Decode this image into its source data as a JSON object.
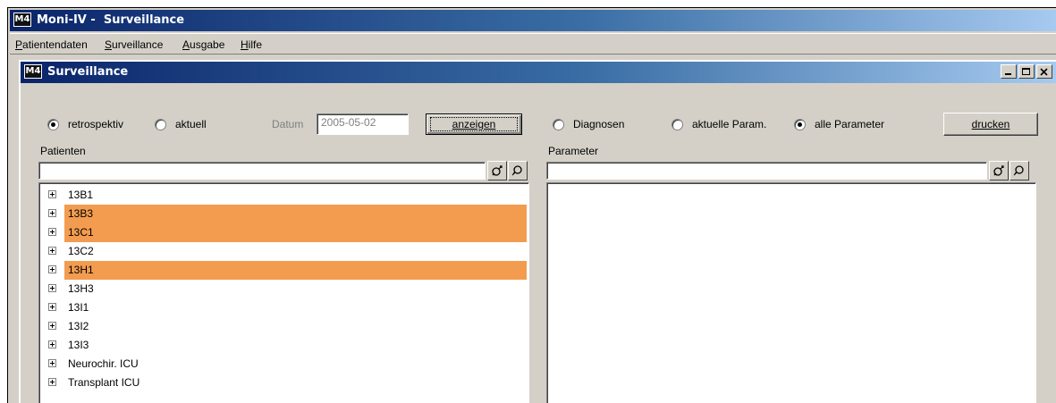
{
  "app": {
    "icon_text": "M4",
    "title": "Moni-IV -  Surveillance"
  },
  "menu": [
    {
      "accel": "P",
      "rest": "atientendaten"
    },
    {
      "accel": "S",
      "rest": "urveillance"
    },
    {
      "accel": "A",
      "rest": "usgabe"
    },
    {
      "accel": "H",
      "rest": "ilfe"
    }
  ],
  "child_window": {
    "icon_text": "M4",
    "title": "Surveillance"
  },
  "controls": {
    "mode_retrospektiv": {
      "label": "retrospektiv",
      "checked": true
    },
    "mode_aktuell": {
      "label": "aktuell",
      "checked": false
    },
    "datum_label": "Datum",
    "datum_value": "2005-05-02",
    "anzeigen_label": "anzeigen",
    "diagnosen": {
      "label": "Diagnosen",
      "checked": false
    },
    "aktuelle_param": {
      "label": "aktuelle Param.",
      "checked": false
    },
    "alle_parameter": {
      "label": "alle Parameter",
      "checked": true
    },
    "drucken_label": "drucken"
  },
  "patients_panel": {
    "title": "Patienten",
    "search_value": "",
    "items": [
      {
        "label": "13B1",
        "highlighted": false
      },
      {
        "label": "13B3",
        "highlighted": true
      },
      {
        "label": "13C1",
        "highlighted": true
      },
      {
        "label": "13C2",
        "highlighted": false
      },
      {
        "label": "13H1",
        "highlighted": true
      },
      {
        "label": "13H3",
        "highlighted": false
      },
      {
        "label": "13I1",
        "highlighted": false
      },
      {
        "label": "13I2",
        "highlighted": false
      },
      {
        "label": "13I3",
        "highlighted": false
      },
      {
        "label": "Neurochir. ICU",
        "highlighted": false
      },
      {
        "label": "Transplant ICU",
        "highlighted": false
      }
    ],
    "highlight_color": "#f39c4f"
  },
  "parameter_panel": {
    "title": "Parameter",
    "search_value": "",
    "items": []
  },
  "icons": {
    "search_next": "magnifier-up-icon",
    "search_prev": "magnifier-down-icon"
  },
  "colors": {
    "titlebar_start": "#0a246a",
    "titlebar_end": "#a6caf0",
    "face": "#d4d0c8"
  }
}
